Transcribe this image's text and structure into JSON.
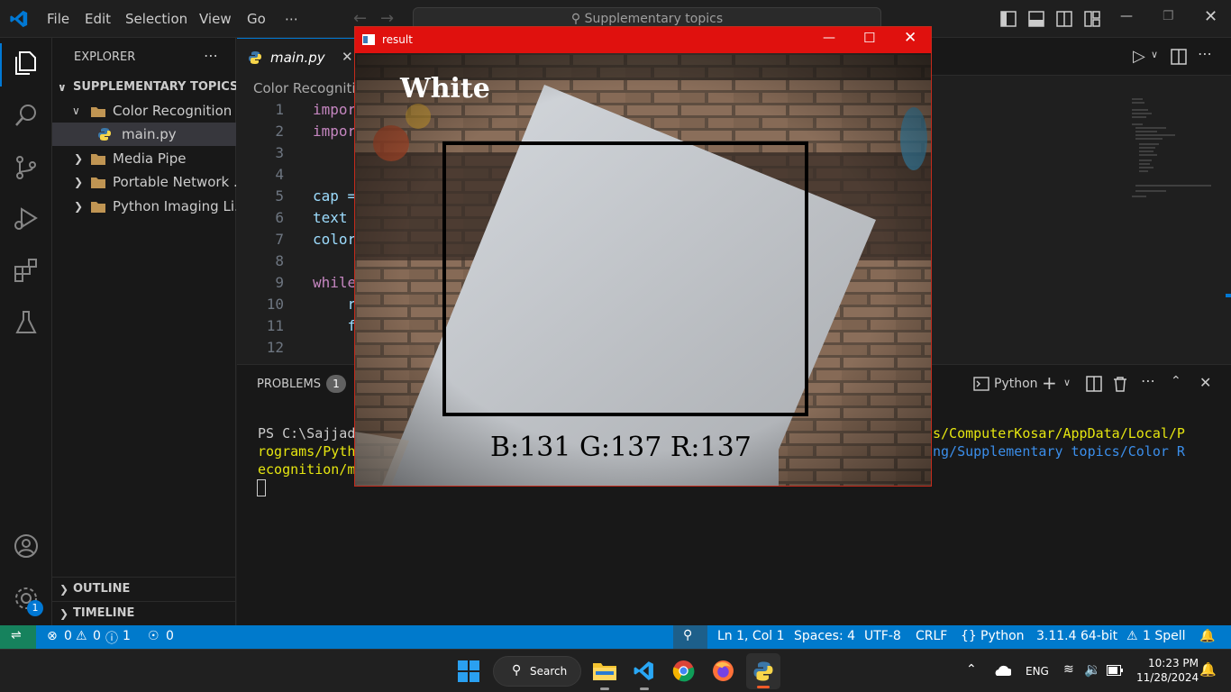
{
  "titlebar": {
    "menu": [
      "File",
      "Edit",
      "Selection",
      "View",
      "Go"
    ],
    "more": "⋯",
    "search_text": "Supplementary topics"
  },
  "sidebar": {
    "header": "EXPLORER",
    "more": "⋯",
    "root": "SUPPLEMENTARY TOPICS",
    "items": [
      {
        "label": "Color Recognition"
      },
      {
        "label": "main.py"
      },
      {
        "label": "Media Pipe"
      },
      {
        "label": "Portable Network ..."
      },
      {
        "label": "Python Imaging Li..."
      }
    ],
    "outline": "OUTLINE",
    "timeline": "TIMELINE"
  },
  "editor": {
    "tab_label": "main.py",
    "breadcrumb": "Color Recognitio",
    "line_numbers": [
      "1",
      "2",
      "3",
      "4",
      "5",
      "6",
      "7",
      "8",
      "9",
      "10",
      "11",
      "12"
    ],
    "code_lines": [
      {
        "text": "impor",
        "kind": "kw"
      },
      {
        "text": "impor",
        "kind": "kw"
      },
      {
        "text": "",
        "kind": "plain"
      },
      {
        "text": "",
        "kind": "plain"
      },
      {
        "text": "cap =",
        "kind": "var"
      },
      {
        "text": "text ",
        "kind": "var"
      },
      {
        "text": "color",
        "kind": "var"
      },
      {
        "text": "",
        "kind": "plain"
      },
      {
        "text": "while",
        "kind": "kw"
      },
      {
        "text": "    r",
        "kind": "var"
      },
      {
        "text": "    f",
        "kind": "var"
      },
      {
        "text": "",
        "kind": "plain"
      }
    ]
  },
  "panel": {
    "problems_label": "PROBLEMS",
    "problems_count": "1",
    "terminal_name": "Python",
    "terminal_lines": [
      {
        "a": "PS C:\\Sajjad",
        "b": "s/ComputerKosar/AppData/Local/P"
      },
      {
        "a": "rograms/Pyth",
        "b": "ng/Supplementary topics/Color R"
      },
      {
        "a": "ecognition/m",
        "b": ""
      }
    ]
  },
  "status": {
    "errors": "0",
    "warnings": "0",
    "infos": "1",
    "ports": "0",
    "position": "Ln 1, Col 1",
    "spaces": "Spaces: 4",
    "encoding": "UTF-8",
    "eol": "CRLF",
    "language": "Python",
    "interpreter": "3.11.4 64-bit",
    "spell": "1 Spell",
    "settings_badge": "1"
  },
  "cv_window": {
    "title": "result",
    "detected_color": "White",
    "bgr_text": "B:131 G:137 R:137"
  },
  "taskbar": {
    "search": "Search",
    "lang": "ENG",
    "time": "10:23 PM",
    "date": "11/28/2024"
  },
  "colors": {
    "accent": "#007acc",
    "cv_titlebar": "#e0110e",
    "keyword": "#c586c0",
    "variable": "#9cdcfe"
  }
}
